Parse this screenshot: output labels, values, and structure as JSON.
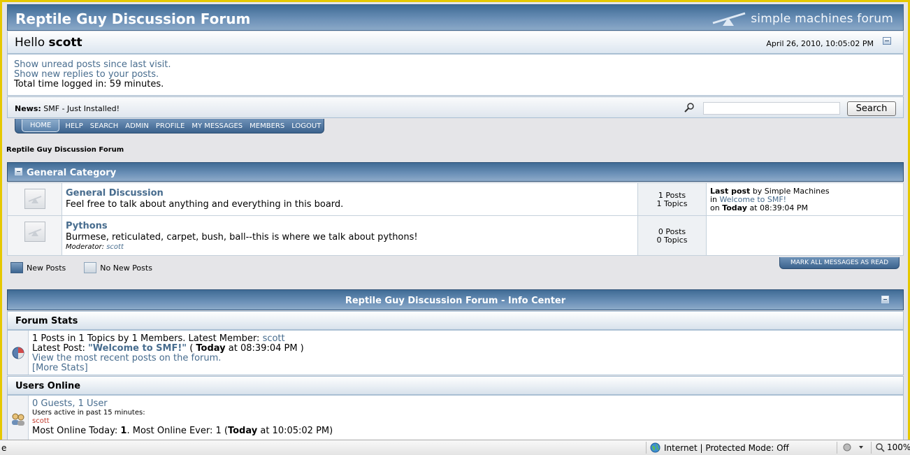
{
  "header": {
    "forum_name": "Reptile Guy Discussion Forum",
    "logo_text": "simple machines forum"
  },
  "hello": {
    "prefix": "Hello",
    "username": "scott",
    "date": "April 26, 2010, 10:05:02 PM"
  },
  "user_info": {
    "unread_link": "Show unread posts since last visit.",
    "replies_link": "Show new replies to your posts.",
    "time_logged": "Total time logged in: 59 minutes."
  },
  "news": {
    "label": "News:",
    "text": "SMF - Just Installed!",
    "search_value": "",
    "search_button": "Search"
  },
  "menu": {
    "items": [
      "HOME",
      "HELP",
      "SEARCH",
      "ADMIN",
      "PROFILE",
      "MY MESSAGES",
      "MEMBERS",
      "LOGOUT"
    ]
  },
  "breadcrumb": "Reptile Guy Discussion Forum",
  "category": {
    "title": "General Category",
    "boards": [
      {
        "name": "General Discussion",
        "description": "Feel free to talk about anything and everything in this board.",
        "posts": "1 Posts",
        "topics": "1 Topics",
        "last_post_label": "Last post",
        "last_post_by": "by Simple Machines",
        "last_post_in": "in",
        "last_post_topic": "Welcome to SMF!",
        "last_post_on": "on",
        "last_post_day": "Today",
        "last_post_time": "at 08:39:04 PM"
      },
      {
        "name": "Pythons",
        "description": "Burmese, reticulated, carpet, bush, ball--this is where we talk about pythons!",
        "moderator_label": "Moderator:",
        "moderator": "scott",
        "posts": "0 Posts",
        "topics": "0 Topics"
      }
    ]
  },
  "legend": {
    "new_posts": "New Posts",
    "no_new_posts": "No New Posts",
    "mark_read": "MARK ALL MESSAGES AS READ"
  },
  "info_center": {
    "title": "Reptile Guy Discussion Forum - Info Center",
    "forum_stats": {
      "heading": "Forum Stats",
      "summary": "1 Posts in 1 Topics by 1 Members. Latest Member:",
      "latest_member": "scott",
      "latest_post_label": "Latest Post:",
      "latest_post_topic": "\"Welcome to SMF!\"",
      "latest_post_open": "(",
      "latest_post_day": "Today",
      "latest_post_time": "at 08:39:04 PM )",
      "recent_link": "View the most recent posts on the forum.",
      "more_stats": "[More Stats]"
    },
    "users_online": {
      "heading": "Users Online",
      "guests_users": "0 Guests, 1 User",
      "active_label": "Users active in past 15 minutes:",
      "active_user": "scott",
      "most_online": "Most Online Today:",
      "most_online_today": "1",
      "most_online_ever": ". Most Online Ever: 1 (",
      "most_online_day": "Today",
      "most_online_time": "at 10:05:02 PM)"
    }
  },
  "statusbar": {
    "left": "e",
    "zone": "Internet | Protected Mode: Off",
    "zoom": "100%"
  }
}
